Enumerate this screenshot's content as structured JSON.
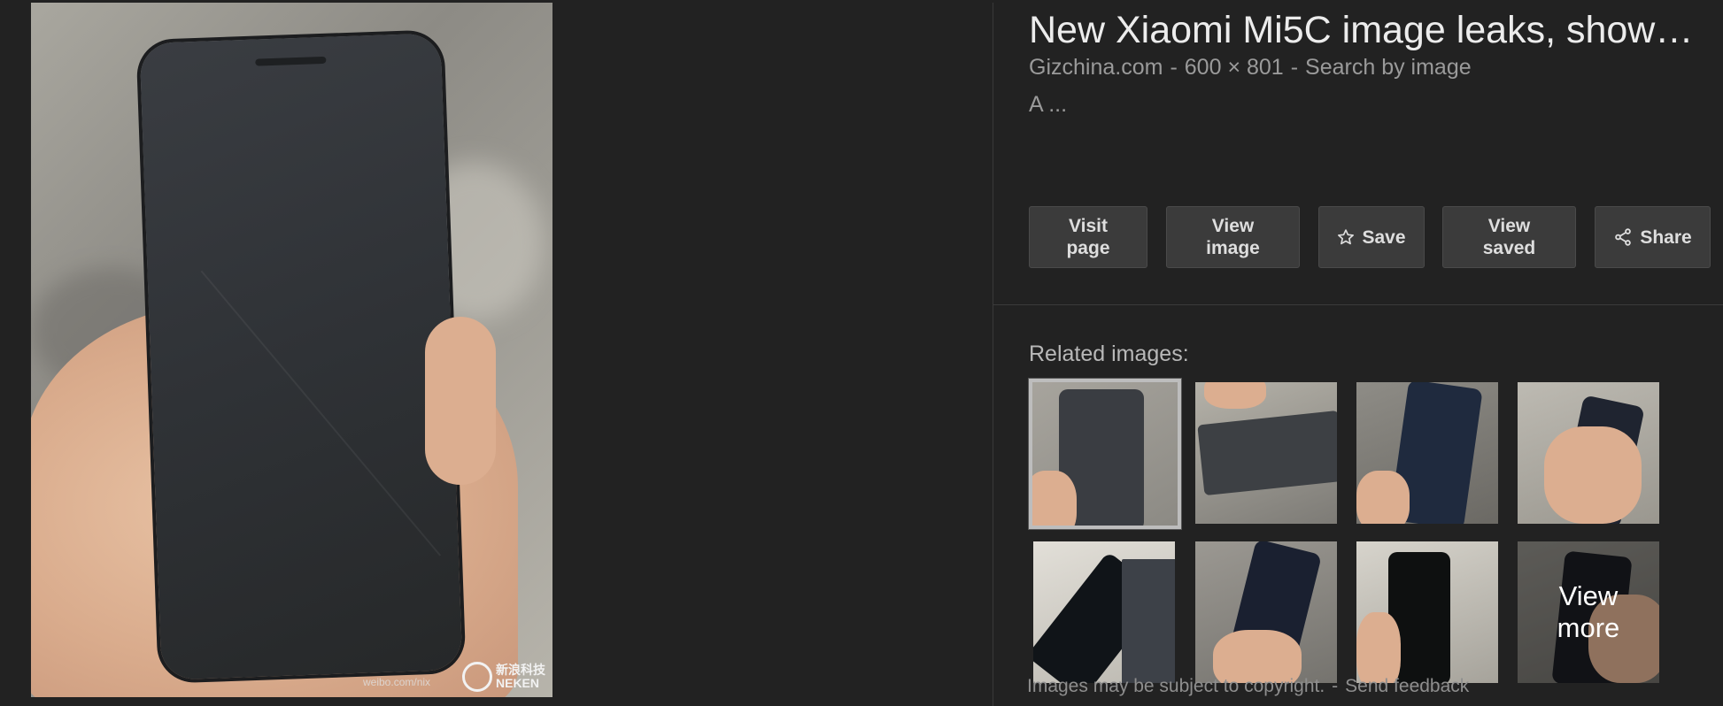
{
  "result": {
    "title": "New Xiaomi Mi5C image leaks, show…",
    "source": "Gizchina.com",
    "dimensions": "600 × 801",
    "search_by_image": "Search by image",
    "separator": "-",
    "description": "A ..."
  },
  "actions": {
    "visit_page": "Visit page",
    "view_image": "View image",
    "save": "Save",
    "view_saved": "View saved",
    "share": "Share"
  },
  "related": {
    "label": "Related images:",
    "view_more": "View more",
    "thumb_count": 8,
    "selected_index": 0
  },
  "watermark": {
    "brand": "新浪科技",
    "brand_sub": "NEKEN",
    "url": "weibo.com/nix"
  },
  "footer": {
    "copyright": "Images may be subject to copyright.",
    "separator": "-",
    "feedback": "Send feedback"
  },
  "colors": {
    "background": "#222222",
    "button_bg": "#3b3b3b",
    "text_primary": "#ececec",
    "text_secondary": "#9a9a9a"
  },
  "icons": {
    "save": "star-outline-icon",
    "share": "share-nodes-icon"
  }
}
